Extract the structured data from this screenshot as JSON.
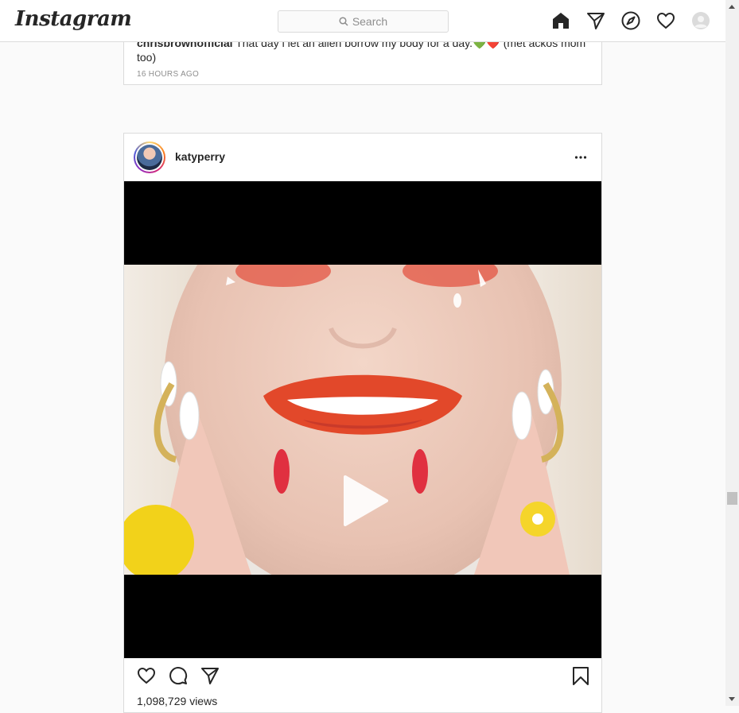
{
  "header": {
    "logo_text": "Instagram",
    "search_placeholder": "Search",
    "nav_icons": [
      "home-icon",
      "direct-icon",
      "explore-icon",
      "activity-icon",
      "profile-avatar"
    ]
  },
  "previous_post": {
    "username": "chrisbrownofficial",
    "caption": "That day i let an alien borrow my body for a day.💚❤️ (met ackos mom too)",
    "timestamp": "16 HOURS AGO"
  },
  "post": {
    "username": "katyperry",
    "more_icon": "more-options-icon",
    "media_type": "video",
    "views_count": "1,098,729",
    "views_label": "views",
    "actions": [
      "like-icon",
      "comment-icon",
      "share-icon",
      "save-icon"
    ]
  },
  "colors": {
    "background": "#fafafa",
    "card": "#ffffff",
    "border": "#dbdbdb",
    "text": "#262626",
    "muted": "#8e8e8e"
  }
}
